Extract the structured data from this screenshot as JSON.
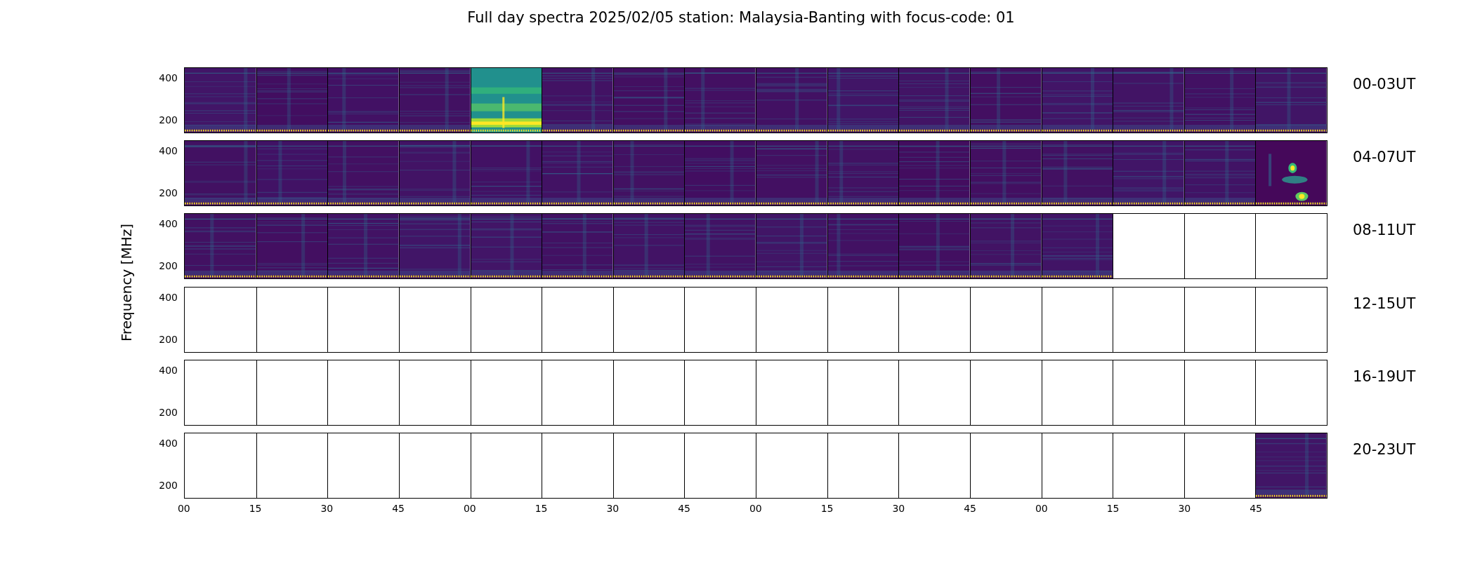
{
  "title": "Full day spectra 2025/02/05 station: Malaysia-Banting with focus-code: 01",
  "y_axis_label": "Frequency [MHz]",
  "rows": [
    {
      "label": "00-03UT",
      "y_ticks": [
        "400",
        "200"
      ],
      "panels": [
        {
          "kind": "quiet"
        },
        {
          "kind": "quiet"
        },
        {
          "kind": "quiet"
        },
        {
          "kind": "quiet"
        },
        {
          "kind": "bright"
        },
        {
          "kind": "quiet"
        },
        {
          "kind": "quiet"
        },
        {
          "kind": "quiet"
        },
        {
          "kind": "quiet"
        },
        {
          "kind": "quiet"
        },
        {
          "kind": "quiet"
        },
        {
          "kind": "quiet"
        },
        {
          "kind": "quiet"
        },
        {
          "kind": "quiet"
        },
        {
          "kind": "quiet"
        },
        {
          "kind": "quiet"
        }
      ]
    },
    {
      "label": "04-07UT",
      "y_ticks": [
        "400",
        "200"
      ],
      "panels": [
        {
          "kind": "quiet"
        },
        {
          "kind": "quiet"
        },
        {
          "kind": "quiet"
        },
        {
          "kind": "quiet"
        },
        {
          "kind": "quiet"
        },
        {
          "kind": "quiet"
        },
        {
          "kind": "quiet"
        },
        {
          "kind": "quiet"
        },
        {
          "kind": "quiet"
        },
        {
          "kind": "quiet"
        },
        {
          "kind": "quiet"
        },
        {
          "kind": "quiet"
        },
        {
          "kind": "quiet"
        },
        {
          "kind": "quiet"
        },
        {
          "kind": "quiet"
        },
        {
          "kind": "burst"
        }
      ]
    },
    {
      "label": "08-11UT",
      "y_ticks": [
        "400",
        "200"
      ],
      "panels": [
        {
          "kind": "quiet"
        },
        {
          "kind": "quiet"
        },
        {
          "kind": "quiet"
        },
        {
          "kind": "quiet"
        },
        {
          "kind": "quiet"
        },
        {
          "kind": "quiet"
        },
        {
          "kind": "quiet"
        },
        {
          "kind": "quiet"
        },
        {
          "kind": "quiet"
        },
        {
          "kind": "quiet"
        },
        {
          "kind": "quiet"
        },
        {
          "kind": "quiet"
        },
        {
          "kind": "quiet"
        },
        {
          "kind": "empty"
        },
        {
          "kind": "empty"
        },
        {
          "kind": "empty"
        }
      ]
    },
    {
      "label": "12-15UT",
      "y_ticks": [
        "400",
        "200"
      ],
      "panels": [
        {
          "kind": "empty"
        },
        {
          "kind": "empty"
        },
        {
          "kind": "empty"
        },
        {
          "kind": "empty"
        },
        {
          "kind": "empty"
        },
        {
          "kind": "empty"
        },
        {
          "kind": "empty"
        },
        {
          "kind": "empty"
        },
        {
          "kind": "empty"
        },
        {
          "kind": "empty"
        },
        {
          "kind": "empty"
        },
        {
          "kind": "empty"
        },
        {
          "kind": "empty"
        },
        {
          "kind": "empty"
        },
        {
          "kind": "empty"
        },
        {
          "kind": "empty"
        }
      ]
    },
    {
      "label": "16-19UT",
      "y_ticks": [
        "400",
        "200"
      ],
      "panels": [
        {
          "kind": "empty"
        },
        {
          "kind": "empty"
        },
        {
          "kind": "empty"
        },
        {
          "kind": "empty"
        },
        {
          "kind": "empty"
        },
        {
          "kind": "empty"
        },
        {
          "kind": "empty"
        },
        {
          "kind": "empty"
        },
        {
          "kind": "empty"
        },
        {
          "kind": "empty"
        },
        {
          "kind": "empty"
        },
        {
          "kind": "empty"
        },
        {
          "kind": "empty"
        },
        {
          "kind": "empty"
        },
        {
          "kind": "empty"
        },
        {
          "kind": "empty"
        }
      ]
    },
    {
      "label": "20-23UT",
      "y_ticks": [
        "400",
        "200"
      ],
      "panels": [
        {
          "kind": "empty"
        },
        {
          "kind": "empty"
        },
        {
          "kind": "empty"
        },
        {
          "kind": "empty"
        },
        {
          "kind": "empty"
        },
        {
          "kind": "empty"
        },
        {
          "kind": "empty"
        },
        {
          "kind": "empty"
        },
        {
          "kind": "empty"
        },
        {
          "kind": "empty"
        },
        {
          "kind": "empty"
        },
        {
          "kind": "empty"
        },
        {
          "kind": "empty"
        },
        {
          "kind": "empty"
        },
        {
          "kind": "empty"
        },
        {
          "kind": "quiet"
        }
      ]
    }
  ],
  "x_tick_labels": [
    "00",
    "15",
    "30",
    "45",
    "00",
    "15",
    "30",
    "45",
    "00",
    "15",
    "30",
    "45",
    "00",
    "15",
    "30",
    "45"
  ]
}
